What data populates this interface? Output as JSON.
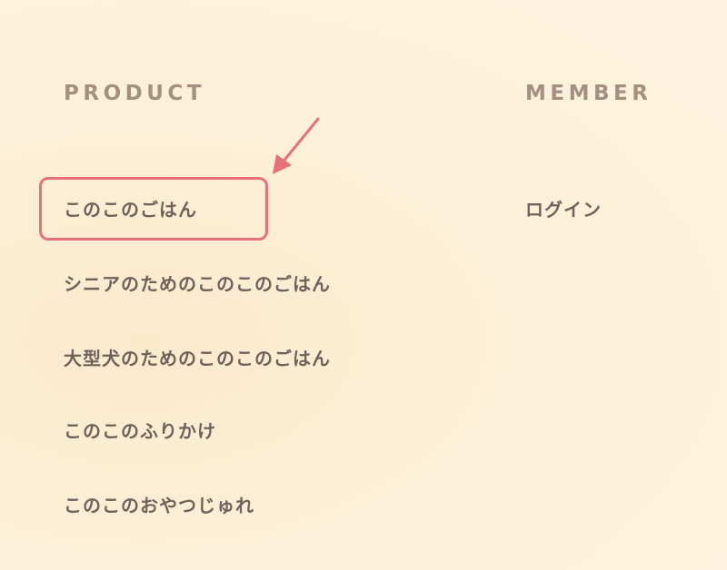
{
  "product": {
    "heading": "PRODUCT",
    "items": [
      {
        "label": "このこのごはん"
      },
      {
        "label": "シニアのためのこのこのごはん"
      },
      {
        "label": "大型犬のためのこのこのごはん"
      },
      {
        "label": "このこのふりかけ"
      },
      {
        "label": "このこのおやつじゅれ"
      }
    ]
  },
  "member": {
    "heading": "MEMBER",
    "items": [
      {
        "label": "ログイン"
      }
    ]
  },
  "annotation": {
    "icon": "arrow-icon",
    "color": "#e8707a"
  }
}
